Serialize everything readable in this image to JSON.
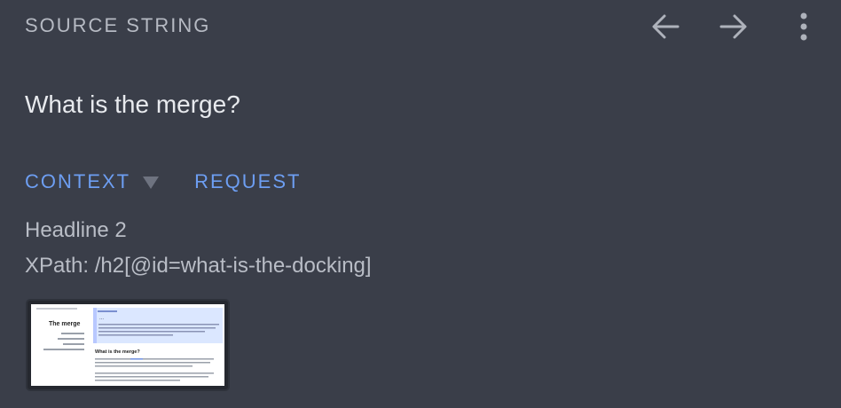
{
  "header": {
    "title": "SOURCE STRING",
    "back_icon": "arrow-left-icon",
    "forward_icon": "arrow-right-icon",
    "menu_icon": "more-vertical-icon"
  },
  "source_string": "What is the merge?",
  "tabs": {
    "context_label": "CONTEXT",
    "request_label": "REQUEST"
  },
  "context": {
    "element_type": "Headline 2",
    "xpath": "XPath: /h2[@id=what-is-the-docking]"
  },
  "screenshot": {
    "sidebar_title": "The merge",
    "banner_heading": "...",
    "section_heading": "What is the merge?"
  },
  "colors": {
    "background": "#3a3e49",
    "accent": "#6d9ef2",
    "muted_text": "#b6bac3"
  }
}
